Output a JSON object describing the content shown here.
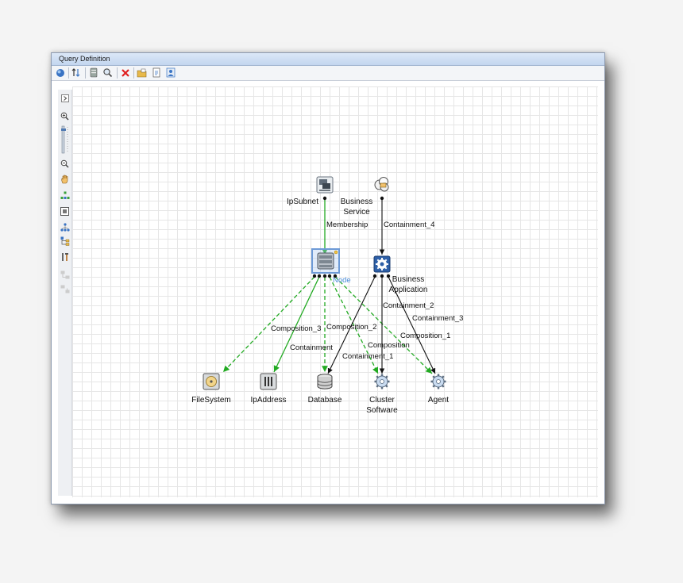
{
  "window": {
    "title": "Query Definition"
  },
  "toolbar": {
    "icons": [
      "globe-icon",
      "sort-icon",
      "database-icon",
      "search-icon",
      "delete-icon",
      "folder-icon",
      "export-icon",
      "user-icon"
    ],
    "delete_color": "#e02020"
  },
  "sidebar": {
    "icons": [
      "expand-icon",
      "zoom-in-icon",
      "zoom-slider-icon",
      "zoom-out-icon",
      "pan-hand-icon",
      "layout-icon",
      "fit-icon",
      "hierarchy-icon",
      "tree-icon",
      "tools-icon",
      "disabled-icon",
      "disabled-icon"
    ]
  },
  "nodes": {
    "ipsubnet": "IpSubnet",
    "business_service": "Business\nService",
    "node": "Node",
    "business_application": "Business\nApplication",
    "filesystem": "FileSystem",
    "ipaddress": "IpAddress",
    "database": "Database",
    "cluster_software": "Cluster\nSoftware",
    "agent": "Agent"
  },
  "edges": {
    "membership": "Membership",
    "containment_4": "Containment_4",
    "composition_3": "Composition_3",
    "composition_2": "Composition_2",
    "containment": "Containment",
    "containment_2": "Containment_2",
    "containment_3": "Containment_3",
    "composition_1": "Composition_1",
    "composition": "Composition",
    "containment_1": "Containment_1"
  },
  "colors": {
    "green": "#22aa22",
    "black": "#111111",
    "selected": "#6d9ad6",
    "node_label": "#4a8cd8"
  }
}
